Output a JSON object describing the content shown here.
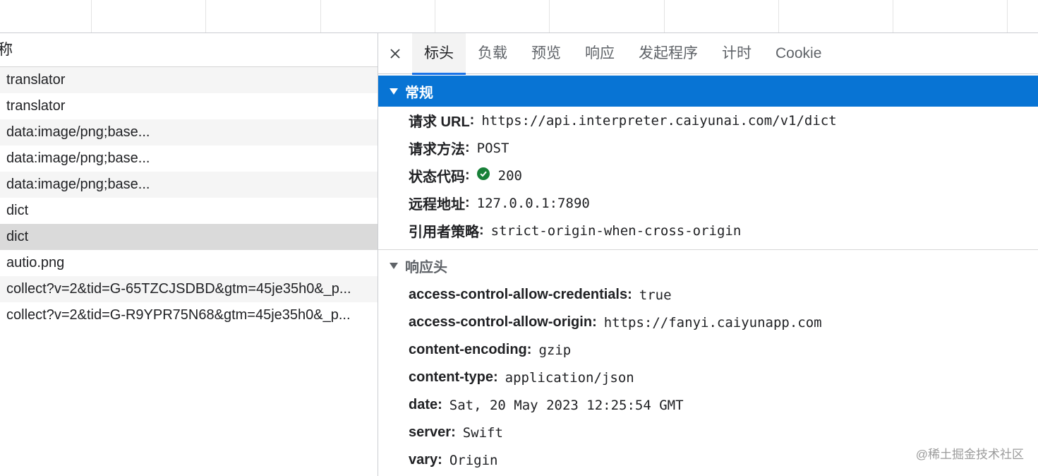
{
  "request_list": {
    "header": "称",
    "rows": [
      {
        "name": "translator"
      },
      {
        "name": "translator"
      },
      {
        "name": "data:image/png;base..."
      },
      {
        "name": "data:image/png;base..."
      },
      {
        "name": "data:image/png;base..."
      },
      {
        "name": "dict"
      },
      {
        "name": "dict"
      },
      {
        "name": "autio.png"
      },
      {
        "name": "collect?v=2&tid=G-65TZCJSDBD&gtm=45je35h0&_p..."
      },
      {
        "name": "collect?v=2&tid=G-R9YPR75N68&gtm=45je35h0&_p..."
      }
    ],
    "selected_index": 6
  },
  "tabs": {
    "close_icon": "close-icon",
    "items": [
      "标头",
      "负载",
      "预览",
      "响应",
      "发起程序",
      "计时",
      "Cookie"
    ],
    "active": "标头"
  },
  "general": {
    "title": "常规",
    "request_url_label": "请求 URL",
    "request_url": "https://api.interpreter.caiyunai.com/v1/dict",
    "method_label": "请求方法",
    "method": "POST",
    "status_label": "状态代码",
    "status": "200",
    "status_color": "#188038",
    "remote_label": "远程地址",
    "remote": "127.0.0.1:7890",
    "referrer_label": "引用者策略",
    "referrer": "strict-origin-when-cross-origin"
  },
  "response_headers": {
    "title": "响应头",
    "items": [
      {
        "key": "access-control-allow-credentials",
        "value": "true"
      },
      {
        "key": "access-control-allow-origin",
        "value": "https://fanyi.caiyunapp.com"
      },
      {
        "key": "content-encoding",
        "value": "gzip"
      },
      {
        "key": "content-type",
        "value": "application/json"
      },
      {
        "key": "date",
        "value": "Sat, 20 May 2023 12:25:54 GMT"
      },
      {
        "key": "server",
        "value": "Swift"
      },
      {
        "key": "vary",
        "value": "Origin"
      }
    ]
  },
  "watermark": "@稀土掘金技术社区",
  "colors": {
    "accent": "#0874d4",
    "tab_underline": "#1a73e8"
  }
}
